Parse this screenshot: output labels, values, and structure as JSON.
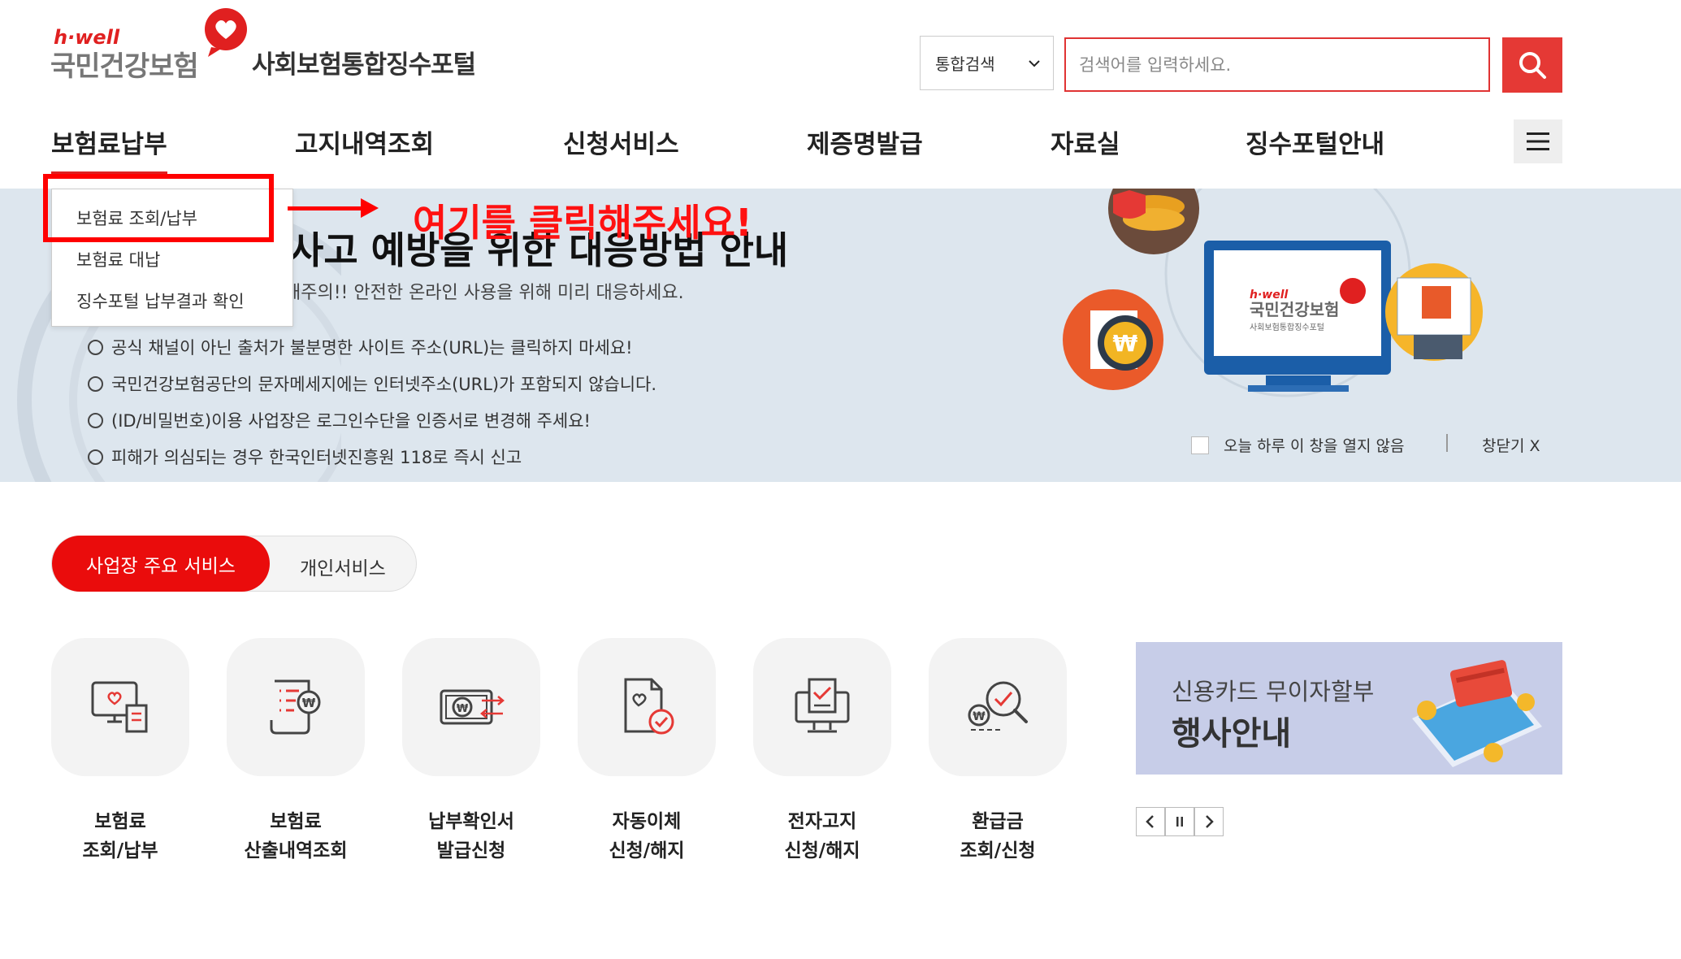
{
  "header": {
    "logo_tag": "h·well",
    "logo_brand": "국민건강보험",
    "portal_title": "사회보험통합징수포털",
    "search_scope": "통합검색",
    "search_placeholder": "검색어를 입력하세요."
  },
  "nav": {
    "items": [
      "보험료납부",
      "고지내역조회",
      "신청서비스",
      "제증명발급",
      "자료실",
      "징수포털안내"
    ]
  },
  "dropdown": {
    "items": [
      "보험료 조회/납부",
      "보험료 대납",
      "징수포털 납부결과 확인"
    ]
  },
  "annotation": "여기를 클릭해주세요!",
  "banner": {
    "title": "사고 예방을 위한 대응방법 안내",
    "subtitle": "해주의!! 안전한 온라인 사용을 위해 미리 대응하세요.",
    "tips": [
      "공식 채널이 아닌 출처가 불분명한 사이트 주소(URL)는 클릭하지 마세요!",
      "국민건강보험공단의 문자메세지에는 인터넷주소(URL)가 포함되지 않습니다.",
      "(ID/비밀번호)이용 사업장은 로그인수단을 인증서로 변경해 주세요!",
      "피해가 의심되는 경우 한국인터넷진흥원 118로 즉시 신고"
    ],
    "hide_today": "오늘 하루 이 창을 열지 않음",
    "close": "창닫기 X",
    "illustration_brand": "국민건강보험",
    "illustration_tag": "h·well",
    "illustration_portal": "사회보험통합징수포털"
  },
  "tabs": {
    "active": "사업장 주요 서비스",
    "inactive": "개인서비스"
  },
  "services": [
    {
      "line1": "보험료",
      "line2": "조회/납부",
      "icon": "monitor-heart-icon"
    },
    {
      "line1": "보험료",
      "line2": "산출내역조회",
      "icon": "document-won-icon"
    },
    {
      "line1": "납부확인서",
      "line2": "발급신청",
      "icon": "won-transfer-icon"
    },
    {
      "line1": "자동이체",
      "line2": "신청/해지",
      "icon": "document-check-icon"
    },
    {
      "line1": "전자고지",
      "line2": "신청/해지",
      "icon": "monitor-check-icon"
    },
    {
      "line1": "환급금",
      "line2": "조회/신청",
      "icon": "search-won-icon"
    }
  ],
  "promo": {
    "line1": "신용카드 무이자할부",
    "line2": "행사안내"
  },
  "colors": {
    "accent": "#e02020",
    "banner_bg": "#dde6ee",
    "promo_bg": "#c7cde8"
  }
}
